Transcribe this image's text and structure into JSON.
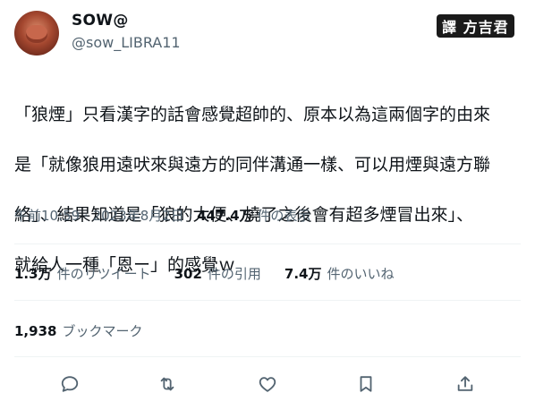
{
  "author": {
    "display_name": "SOW@",
    "handle": "@sow_LIBRA11"
  },
  "watermark": "譯 方吉君",
  "tweet": {
    "text_lines": [
      "「狼煙」只看漢字的話會感覺超帥的、原本以為這兩個字的由來",
      "是「就像狼用遠吠來與遠方的同伴溝通一樣、可以用煙與遠方聯",
      "絡」、結果知道是「狼的大便、燒了之後會有超多煙冒出來」、",
      "就給人一種「恩ー」的感覺ｗ"
    ],
    "timestamp": "午前10:59 · 2023年8月2日 · ",
    "views_count": "447.4万",
    "views_label": " 件の表示"
  },
  "stats": {
    "retweets": {
      "count": "1.3万",
      "label": "件のリツイート"
    },
    "quotes": {
      "count": "302",
      "label": "件の引用"
    },
    "likes": {
      "count": "7.4万",
      "label": "件のいいね"
    },
    "bookmarks": {
      "count": "1,938",
      "label": "ブックマーク"
    }
  },
  "actions": [
    "reply-icon",
    "retweet-icon",
    "like-icon",
    "bookmark-icon",
    "share-icon"
  ]
}
